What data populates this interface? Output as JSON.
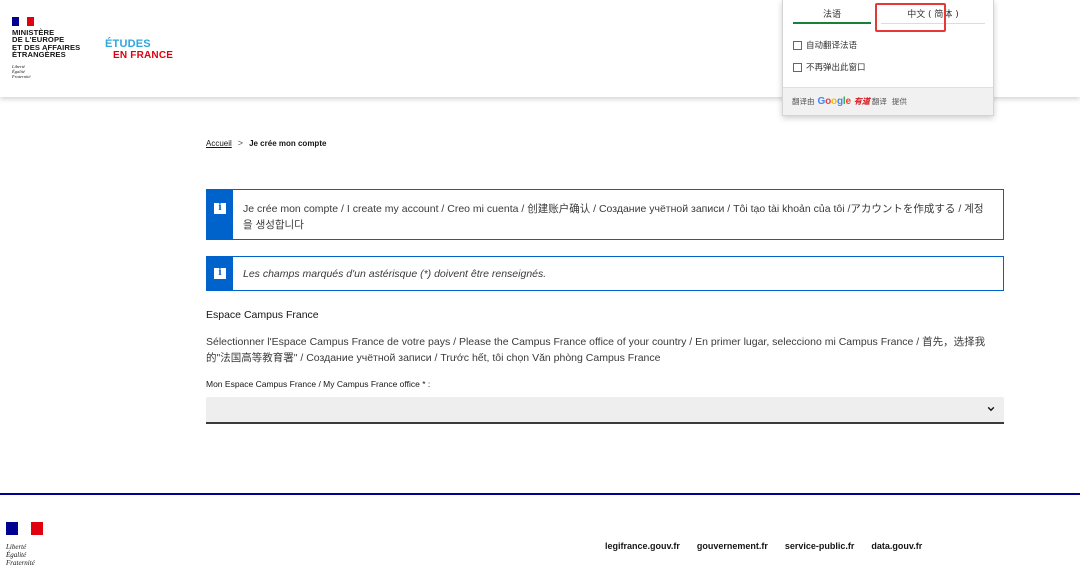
{
  "header": {
    "ministry_lines": [
      "MINISTÈRE",
      "DE L'EUROPE",
      "ET DES AFFAIRES",
      "ÉTRANGÈRES"
    ],
    "motto_lines": [
      "Liberté",
      "Égalité",
      "Fraternité"
    ],
    "logo_top": "ÉTUDES",
    "logo_bottom": "EN FRANCE"
  },
  "translate_popup": {
    "tab_source": "法语",
    "tab_target": "中文 ( 简体 )",
    "option_auto": "自动翻译法语",
    "option_no_popup": "不再弹出此窗口",
    "footer_prefix": "翻译由",
    "footer_google": "Google",
    "footer_youdao": "有道",
    "footer_mid": "翻译",
    "footer_suffix": "提供"
  },
  "breadcrumb": {
    "home": "Accueil",
    "separator": ">",
    "current": "Je crée mon compte"
  },
  "alerts": {
    "account_title": "Je crée mon compte / I create my account / Creo mi cuenta / 创建账户确认 / Создание учётной записи / Tôi tạo tài khoản của tôi /アカウントを作成する / 계정을 생성합니다",
    "required_notice": "Les champs marqués d'un astérisque (*) doivent être renseignés."
  },
  "form": {
    "section_title": "Espace Campus France",
    "description": "Sélectionner l'Espace Campus France de votre pays / Please the Campus France office of your country / En primer lugar, selecciono mi Campus France / 首先，选择我的\"法国高等教育署\" / Создание учётной записи / Trước hết, tôi chọn Văn phòng Campus France",
    "select_label": "Mon Espace Campus France / My Campus France office * :",
    "select_value": ""
  },
  "footer": {
    "motto_lines": [
      "Liberté",
      "Égalité",
      "Fraternité"
    ],
    "links": [
      "legifrance.gouv.fr",
      "gouvernement.fr",
      "service-public.fr",
      "data.gouv.fr"
    ]
  },
  "colors": {
    "flag_blue": "#000091",
    "flag_red": "#e1000f",
    "alert_blue": "#0063cb",
    "logo_cyan": "#2ea7db",
    "highlight_red": "#e53935"
  }
}
